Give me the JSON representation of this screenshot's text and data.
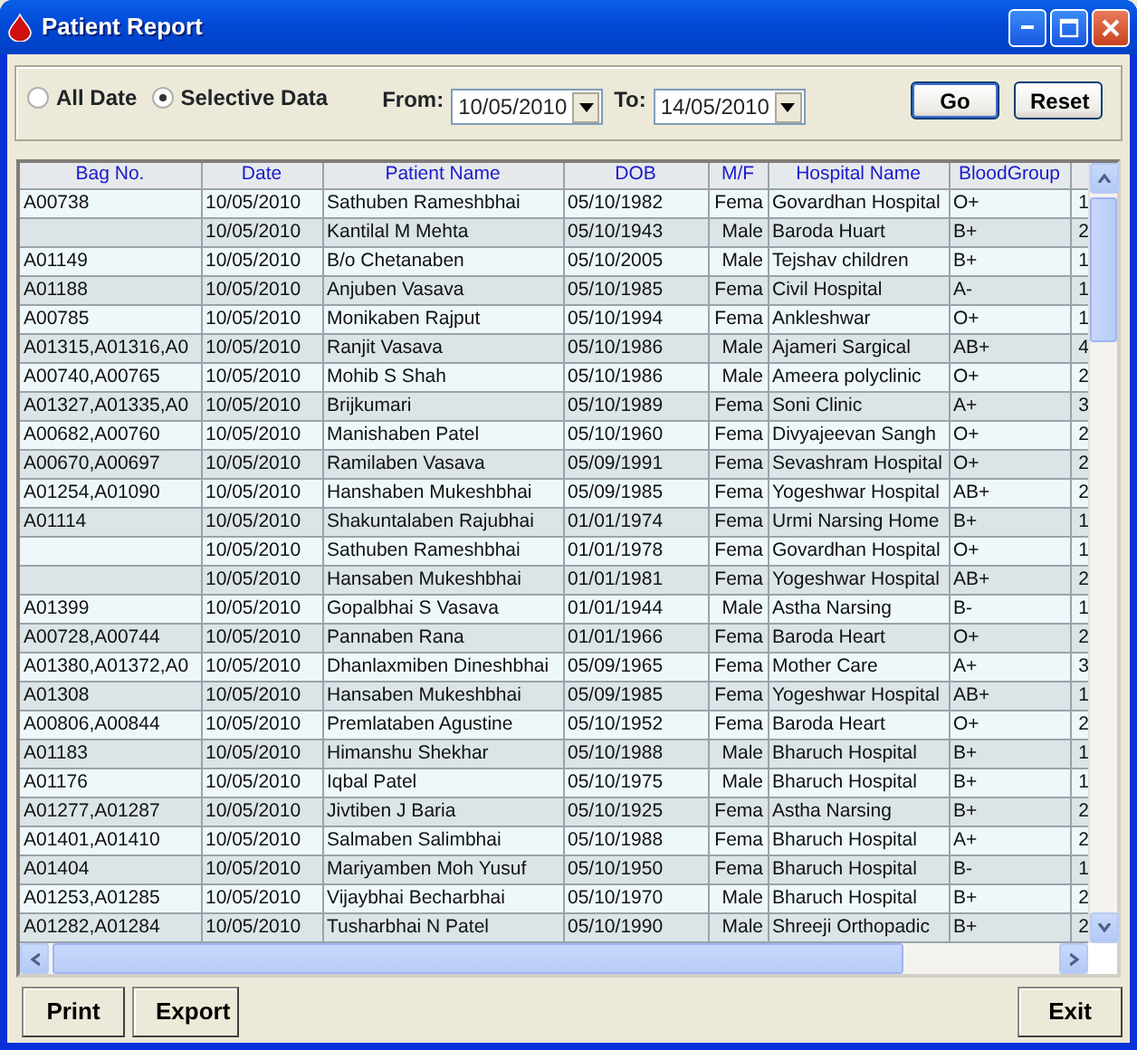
{
  "window": {
    "title": "Patient Report"
  },
  "filter": {
    "options": [
      {
        "label": "All Date",
        "selected": false
      },
      {
        "label": "Selective Data",
        "selected": true
      }
    ],
    "from": {
      "label": "From:",
      "value": "10/05/2010"
    },
    "to": {
      "label": "To:",
      "value": "14/05/2010"
    },
    "buttons": [
      {
        "label": "Go",
        "default": true
      },
      {
        "label": "Reset",
        "default": false
      }
    ]
  },
  "table": {
    "columns": [
      "Bag No.",
      "Date",
      "Patient Name",
      "DOB",
      "M/F",
      "Hospital Name",
      "BloodGroup"
    ],
    "rows": [
      [
        "A00738",
        "10/05/2010",
        "Sathuben Rameshbhai",
        "05/10/1982",
        "Fema",
        "Govardhan Hospital",
        "O+",
        "1"
      ],
      [
        "",
        "10/05/2010",
        "Kantilal M Mehta",
        "05/10/1943",
        "Male",
        "Baroda Huart",
        "B+",
        "2"
      ],
      [
        "A01149",
        "10/05/2010",
        "B/o Chetanaben",
        "05/10/2005",
        "Male",
        "Tejshav children",
        "B+",
        "1"
      ],
      [
        "A01188",
        "10/05/2010",
        "Anjuben Vasava",
        "05/10/1985",
        "Fema",
        "Civil Hospital",
        "A-",
        "1"
      ],
      [
        "A00785",
        "10/05/2010",
        "Monikaben Rajput",
        "05/10/1994",
        "Fema",
        "Ankleshwar",
        "O+",
        "1"
      ],
      [
        "A01315,A01316,A0",
        "10/05/2010",
        "Ranjit Vasava",
        "05/10/1986",
        "Male",
        "Ajameri Sargical",
        "AB+",
        "4"
      ],
      [
        "A00740,A00765",
        "10/05/2010",
        "Mohib S Shah",
        "05/10/1986",
        "Male",
        "Ameera polyclinic",
        "O+",
        "2"
      ],
      [
        "A01327,A01335,A0",
        "10/05/2010",
        "Brijkumari",
        "05/10/1989",
        "Fema",
        "Soni Clinic",
        "A+",
        "3"
      ],
      [
        "A00682,A00760",
        "10/05/2010",
        "Manishaben Patel",
        "05/10/1960",
        "Fema",
        "Divyajeevan Sangh",
        "O+",
        "2"
      ],
      [
        "A00670,A00697",
        "10/05/2010",
        "Ramilaben Vasava",
        "05/09/1991",
        "Fema",
        "Sevashram Hospital",
        "O+",
        "2"
      ],
      [
        "A01254,A01090",
        "10/05/2010",
        "Hanshaben Mukeshbhai",
        "05/09/1985",
        "Fema",
        "Yogeshwar Hospital",
        "AB+",
        "2"
      ],
      [
        "A01114",
        "10/05/2010",
        "Shakuntalaben Rajubhai",
        "01/01/1974",
        "Fema",
        "Urmi Narsing Home",
        "B+",
        "1"
      ],
      [
        "",
        "10/05/2010",
        "Sathuben Rameshbhai",
        "01/01/1978",
        "Fema",
        "Govardhan Hospital",
        "O+",
        "1"
      ],
      [
        "",
        "10/05/2010",
        "Hansaben Mukeshbhai",
        "01/01/1981",
        "Fema",
        "Yogeshwar Hospital",
        "AB+",
        "2"
      ],
      [
        "A01399",
        "10/05/2010",
        "Gopalbhai S Vasava",
        "01/01/1944",
        "Male",
        "Astha Narsing",
        "B-",
        "1"
      ],
      [
        "A00728,A00744",
        "10/05/2010",
        "Pannaben Rana",
        "01/01/1966",
        "Fema",
        "Baroda Heart",
        "O+",
        "2"
      ],
      [
        "A01380,A01372,A0",
        "10/05/2010",
        "Dhanlaxmiben Dineshbhai",
        "05/09/1965",
        "Fema",
        "Mother Care",
        "A+",
        "3"
      ],
      [
        "A01308",
        "10/05/2010",
        "Hansaben Mukeshbhai",
        "05/09/1985",
        "Fema",
        "Yogeshwar Hospital",
        "AB+",
        "1"
      ],
      [
        "A00806,A00844",
        "10/05/2010",
        "Premlataben Agustine",
        "05/10/1952",
        "Fema",
        "Baroda Heart",
        "O+",
        "2"
      ],
      [
        "A01183",
        "10/05/2010",
        "Himanshu Shekhar",
        "05/10/1988",
        "Male",
        "Bharuch Hospital",
        "B+",
        "1"
      ],
      [
        "A01176",
        "10/05/2010",
        "Iqbal Patel",
        "05/10/1975",
        "Male",
        "Bharuch Hospital",
        "B+",
        "1"
      ],
      [
        "A01277,A01287",
        "10/05/2010",
        "Jivtiben J Baria",
        "05/10/1925",
        "Fema",
        "Astha Narsing",
        "B+",
        "2"
      ],
      [
        "A01401,A01410",
        "10/05/2010",
        "Salmaben Salimbhai",
        "05/10/1988",
        "Fema",
        "Bharuch Hospital",
        "A+",
        "2"
      ],
      [
        "A01404",
        "10/05/2010",
        "Mariyamben Moh Yusuf",
        "05/10/1950",
        "Fema",
        "Bharuch Hospital",
        "B-",
        "1"
      ],
      [
        "A01253,A01285",
        "10/05/2010",
        "Vijaybhai Becharbhai",
        "05/10/1970",
        "Male",
        "Bharuch Hospital",
        "B+",
        "2"
      ],
      [
        "A01282,A01284",
        "10/05/2010",
        "Tusharbhai N Patel",
        "05/10/1990",
        "Male",
        "Shreeji Orthopadic",
        "B+",
        "2"
      ]
    ]
  },
  "footer_buttons": [
    "Print",
    "Export",
    "Exit"
  ]
}
